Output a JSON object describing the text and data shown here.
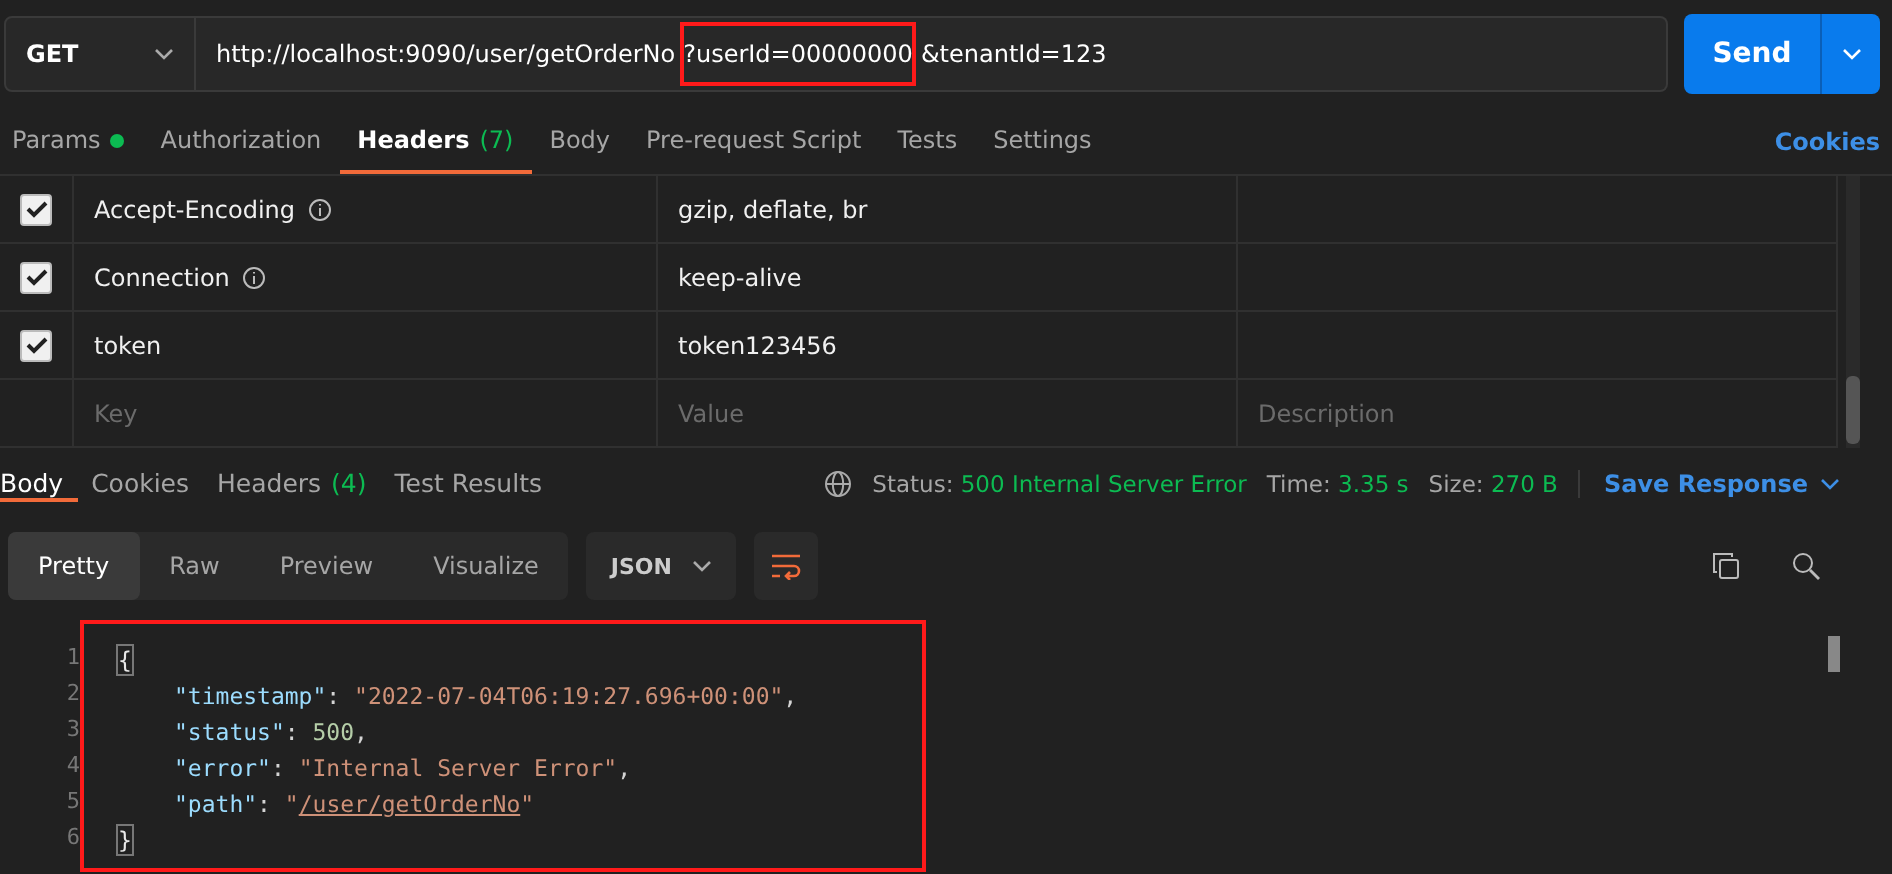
{
  "request": {
    "method": "GET",
    "url_parts": [
      {
        "text": "http://localhost:9090/user/getOrderNo",
        "highlighted": false
      },
      {
        "text": "?userId=00000000",
        "highlighted": true
      },
      {
        "text": "&tenantId=123",
        "highlighted": false
      }
    ],
    "send_label": "Send"
  },
  "request_tabs": [
    {
      "label": "Params",
      "dot": true,
      "selected": false
    },
    {
      "label": "Authorization",
      "dot": false,
      "selected": false
    },
    {
      "label": "Headers",
      "count": "(7)",
      "dot": false,
      "selected": true
    },
    {
      "label": "Body",
      "dot": false,
      "selected": false
    },
    {
      "label": "Pre-request Script",
      "dot": false,
      "selected": false
    },
    {
      "label": "Tests",
      "dot": false,
      "selected": false
    },
    {
      "label": "Settings",
      "dot": false,
      "selected": false
    }
  ],
  "cookies_link": "Cookies",
  "headers": [
    {
      "key": "Accept-Encoding",
      "info": true,
      "value": "gzip, deflate, br",
      "checked": true
    },
    {
      "key": "Connection",
      "info": true,
      "value": "keep-alive",
      "checked": true
    },
    {
      "key": "token",
      "info": false,
      "value": "token123456",
      "checked": true
    }
  ],
  "new_header": {
    "key_placeholder": "Key",
    "value_placeholder": "Value",
    "description_placeholder": "Description"
  },
  "response_tabs": [
    {
      "label": "Body",
      "selected": true
    },
    {
      "label": "Cookies",
      "selected": false
    },
    {
      "label": "Headers",
      "count": "(4)",
      "selected": false
    },
    {
      "label": "Test Results",
      "selected": false
    }
  ],
  "status": {
    "status_label": "Status:",
    "status_value": "500 Internal Server Error",
    "time_label": "Time:",
    "time_value": "3.35 s",
    "size_label": "Size:",
    "size_value": "270 B",
    "save_label": "Save Response"
  },
  "view_modes": [
    {
      "label": "Pretty",
      "selected": true
    },
    {
      "label": "Raw",
      "selected": false
    },
    {
      "label": "Preview",
      "selected": false
    },
    {
      "label": "Visualize",
      "selected": false
    }
  ],
  "format": "JSON",
  "body": {
    "highlighted": true,
    "lines": [
      [
        {
          "kind": "brace",
          "text": "{"
        }
      ],
      [
        {
          "kind": "key",
          "text": "\"timestamp\""
        },
        {
          "kind": "punct",
          "text": ": "
        },
        {
          "kind": "string",
          "text": "\"2022-07-04T06:19:27.696+00:00\""
        },
        {
          "kind": "punct",
          "text": ","
        }
      ],
      [
        {
          "kind": "key",
          "text": "\"status\""
        },
        {
          "kind": "punct",
          "text": ": "
        },
        {
          "kind": "number",
          "text": "500"
        },
        {
          "kind": "punct",
          "text": ","
        }
      ],
      [
        {
          "kind": "key",
          "text": "\"error\""
        },
        {
          "kind": "punct",
          "text": ": "
        },
        {
          "kind": "string",
          "text": "\"Internal Server Error\""
        },
        {
          "kind": "punct",
          "text": ","
        }
      ],
      [
        {
          "kind": "key",
          "text": "\"path\""
        },
        {
          "kind": "punct",
          "text": ": "
        },
        {
          "kind": "string",
          "text": "\""
        },
        {
          "kind": "link",
          "text": "/user/getOrderNo"
        },
        {
          "kind": "string",
          "text": "\""
        }
      ],
      [
        {
          "kind": "brace",
          "text": "}"
        }
      ]
    ],
    "line_numbers": [
      "1",
      "2",
      "3",
      "4",
      "5",
      "6"
    ]
  }
}
